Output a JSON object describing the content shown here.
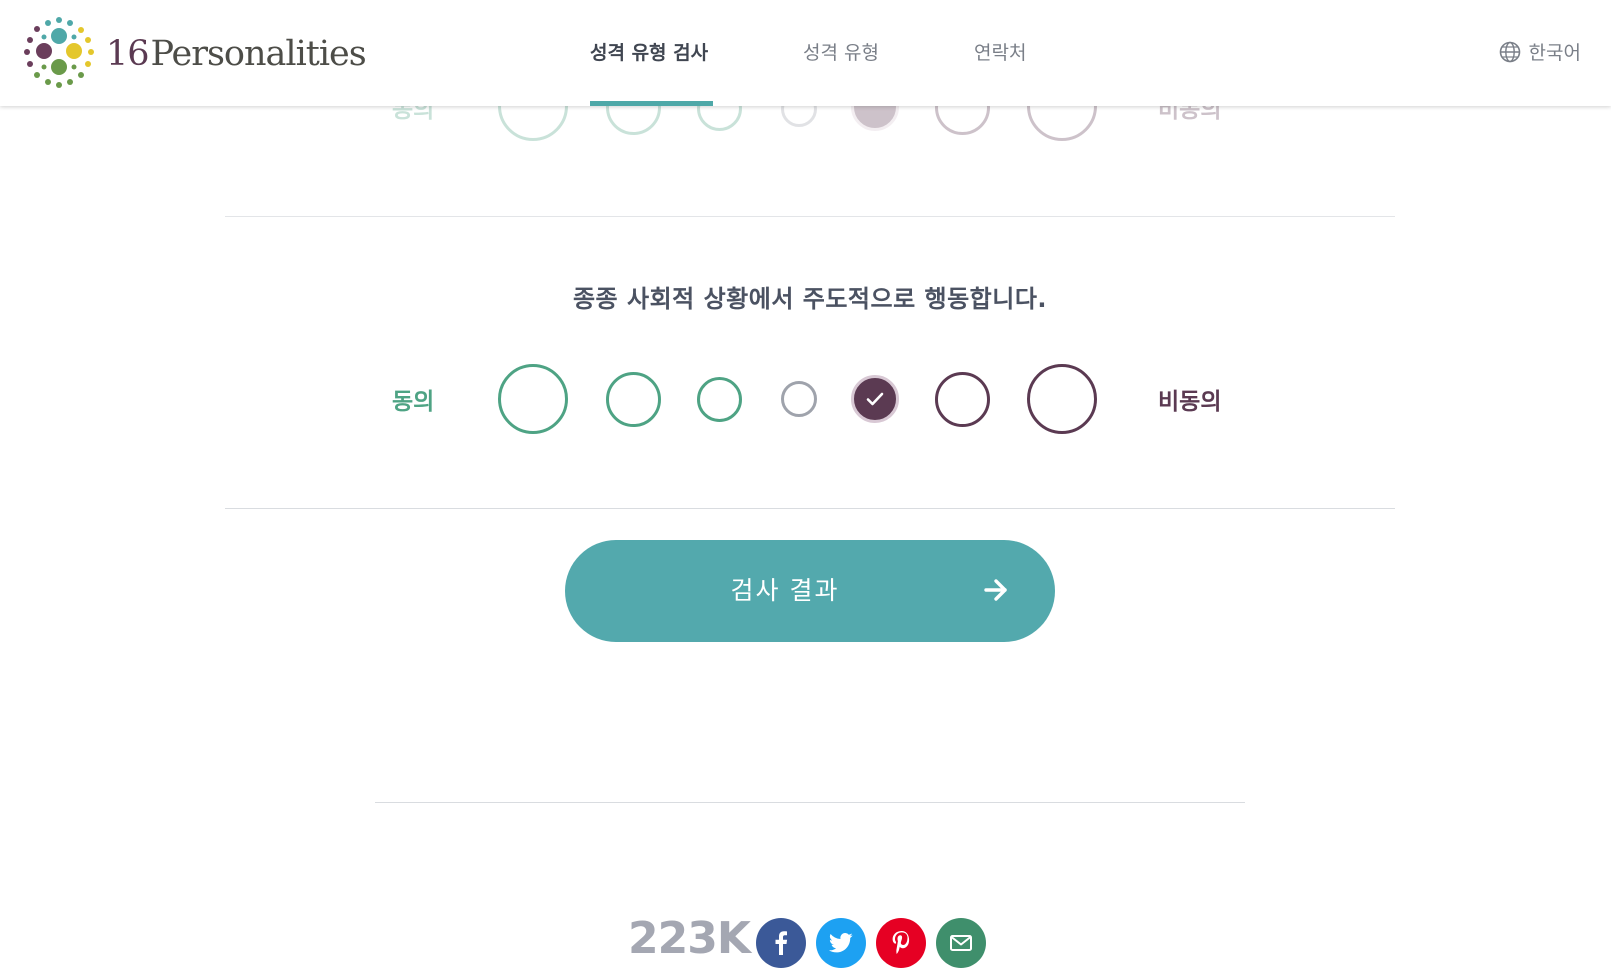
{
  "header": {
    "logo_number": "16",
    "logo_word": "Personalities",
    "nav": [
      {
        "label": "성격 유형 검사",
        "active": true
      },
      {
        "label": "성격 유형",
        "active": false
      },
      {
        "label": "연락처",
        "active": false
      }
    ],
    "language": "한국어"
  },
  "previous_question": {
    "agree_label": "동의",
    "disagree_label": "비동의",
    "selected_index": 4
  },
  "question": {
    "text": "종종 사회적 상황에서 주도적으로 행동합니다.",
    "agree_label": "동의",
    "disagree_label": "비동의",
    "options_count": 7,
    "selected_index": 4
  },
  "submit": {
    "label": "검사 결과"
  },
  "share": {
    "count": "223K",
    "networks": [
      "facebook",
      "twitter",
      "pinterest",
      "email"
    ]
  },
  "colors": {
    "agree": "#4ea384",
    "disagree": "#5b3a52",
    "neutral": "#9fa3ac",
    "accent": "#53a9ad",
    "facebook": "#3b5998",
    "twitter": "#1da1f2",
    "pinterest": "#e60023",
    "email": "#3f8f6c"
  }
}
